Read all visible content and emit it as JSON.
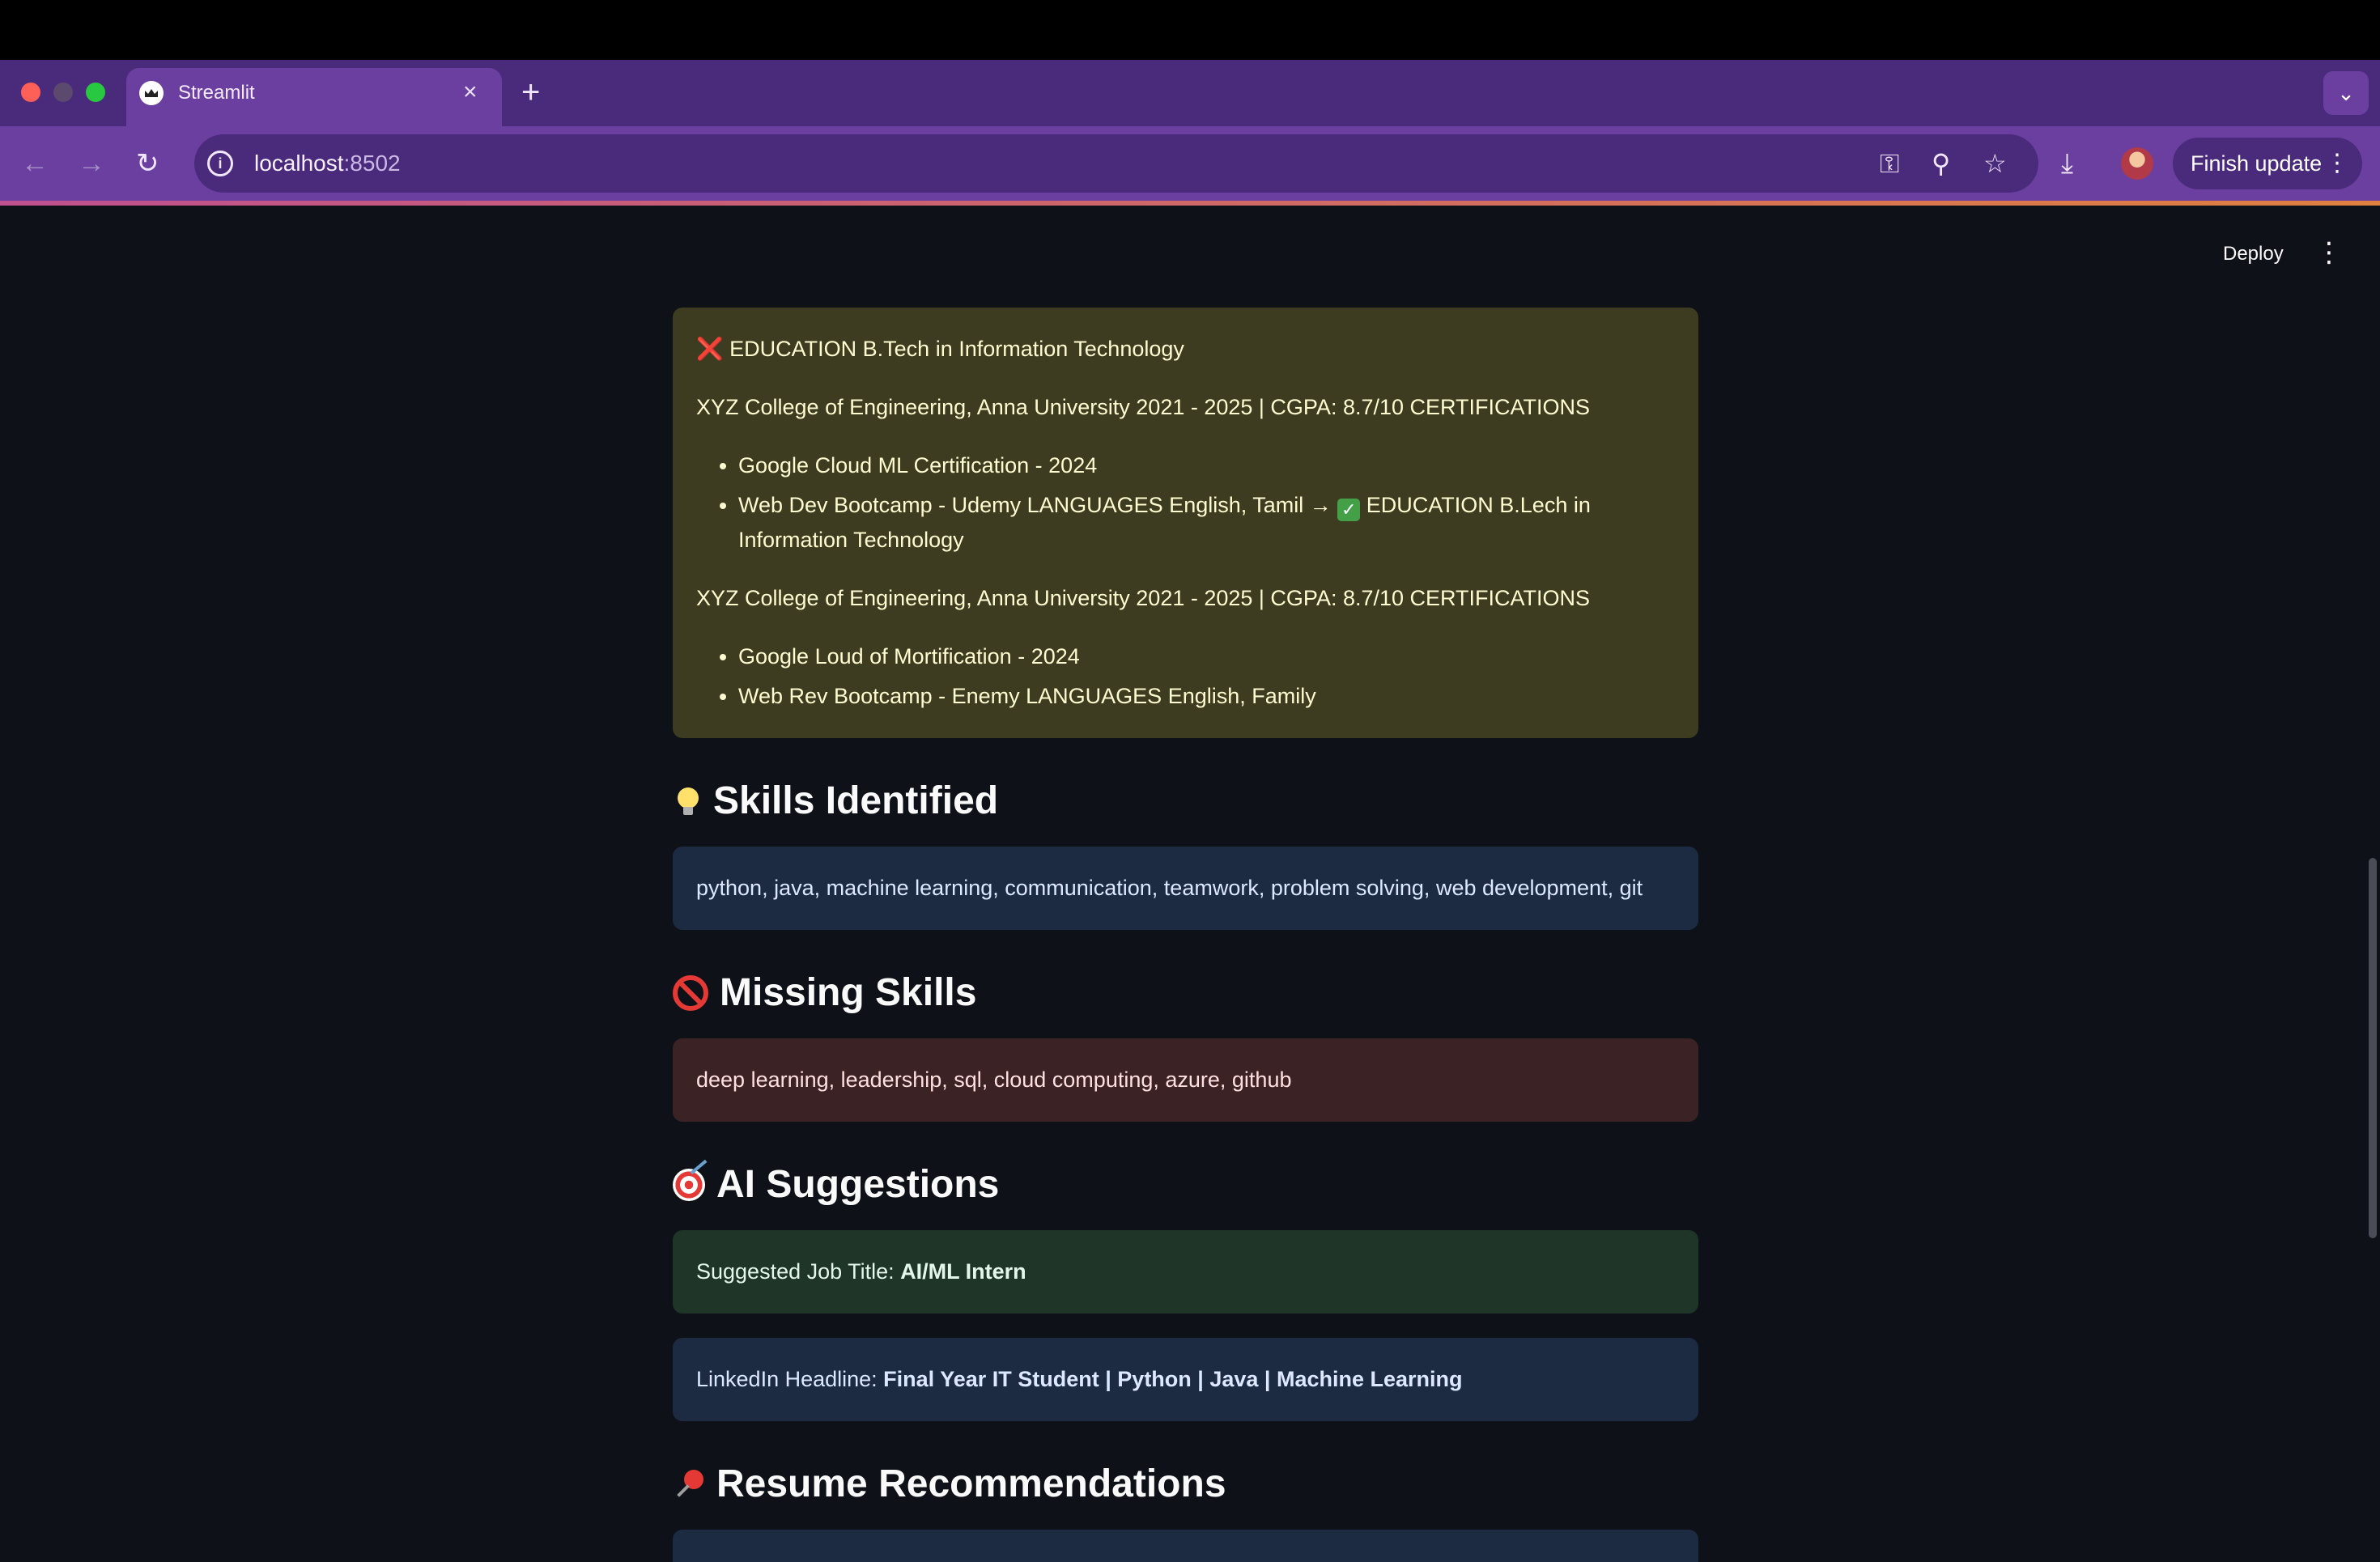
{
  "browser": {
    "tab_title": "Streamlit",
    "close_glyph": "×",
    "new_tab_glyph": "+",
    "tabs_dropdown_glyph": "⌄",
    "url_host": "localhost",
    "url_port": ":8502",
    "back_glyph": "←",
    "forward_glyph": "→",
    "reload_glyph": "↻",
    "info_glyph": "i",
    "key_glyph": "⚿",
    "zoom_glyph": "⚲",
    "star_glyph": "☆",
    "download_glyph": "⤓",
    "finish_update_label": "Finish update",
    "finish_menu_glyph": "⋮"
  },
  "app_header": {
    "deploy_label": "Deploy",
    "menu_glyph": "⋮"
  },
  "education_block": {
    "line1_icon": "❌",
    "line1": "EDUCATION B.Tech in Information Technology",
    "line2": "XYZ College of Engineering, Anna University 2021 - 2025 | CGPA: 8.7/10 CERTIFICATIONS",
    "list1": [
      "Google Cloud ML Certification - 2024",
      "Web Dev Bootcamp - Udemy LANGUAGES English, Tamil → "
    ],
    "list1_item2_check": "✓",
    "list1_item2_tail": " EDUCATION B.Lech in Information Technology",
    "line3": "XYZ College of Engineering, Anna University 2021 - 2025 | CGPA: 8.7/10 CERTIFICATIONS",
    "list2": [
      "Google Loud of Mortification - 2024",
      "Web Rev Bootcamp - Enemy LANGUAGES English, Family"
    ]
  },
  "skills": {
    "heading": "Skills Identified",
    "icon": "lightbulb-icon",
    "text": "python, java, machine learning, communication, teamwork, problem solving, web development, git"
  },
  "missing": {
    "heading": "Missing Skills",
    "icon": "prohibited-icon",
    "text": "deep learning, leadership, sql, cloud computing, azure, github"
  },
  "ai": {
    "heading": "AI Suggestions",
    "icon": "target-icon",
    "job_label": "Suggested Job Title: ",
    "job_value": "AI/ML Intern",
    "linkedin_label": "LinkedIn Headline: ",
    "linkedin_value": "Final Year IT Student | Python | Java | Machine Learning"
  },
  "recommendations": {
    "heading": "Resume Recommendations",
    "icon": "pushpin-icon"
  },
  "colors": {
    "background": "#0e1117",
    "chrome_tab": "#6b3fa0",
    "chrome_bar": "#4a2a7a",
    "warning_bg": "#3d3c21",
    "info_bg": "#1c2a42",
    "error_bg": "#3b2225",
    "success_bg": "#1f3528"
  }
}
